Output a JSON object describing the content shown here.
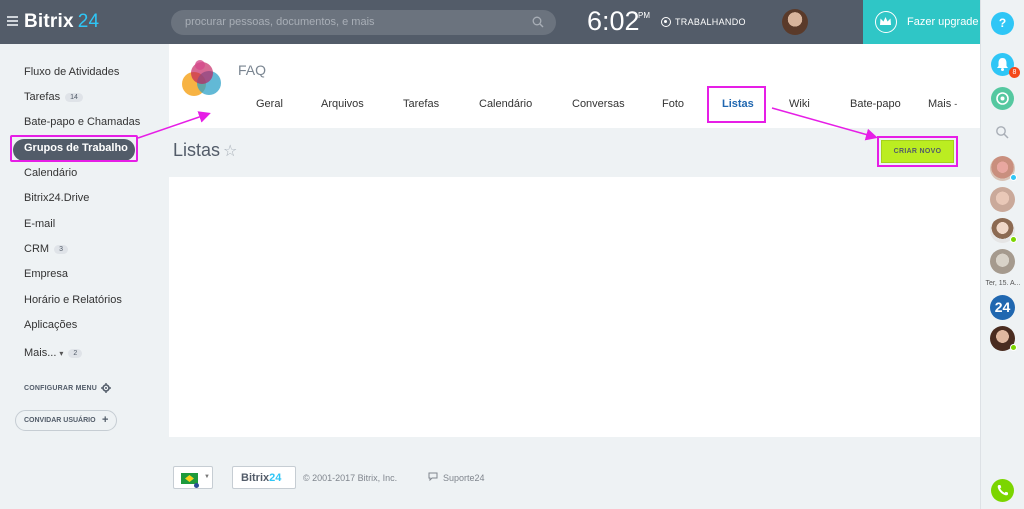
{
  "header": {
    "logo_text": "Bitrix",
    "logo_number": "24",
    "search_placeholder": "procurar pessoas, documentos, e mais",
    "time": "6:02",
    "time_suffix": "PM",
    "work_status": "TRABALHANDO",
    "upgrade_label": "Fazer upgrade"
  },
  "sidebar": {
    "items": [
      {
        "label": "Fluxo de Atividades"
      },
      {
        "label": "Tarefas",
        "count": "14"
      },
      {
        "label": "Bate-papo e Chamadas"
      },
      {
        "label": "Grupos de Trabalho",
        "active": true
      },
      {
        "label": "Calendário"
      },
      {
        "label": "Bitrix24.Drive"
      },
      {
        "label": "E-mail"
      },
      {
        "label": "CRM",
        "count": "3"
      },
      {
        "label": "Empresa"
      },
      {
        "label": "Horário e Relatórios"
      },
      {
        "label": "Aplicações"
      },
      {
        "label": "Mais...",
        "count": "2"
      }
    ],
    "configure_label": "CONFIGURAR MENU",
    "invite_label": "CONVIDAR USUÁRIO"
  },
  "group": {
    "name": "FAQ",
    "tabs": [
      {
        "label": "Geral"
      },
      {
        "label": "Arquivos"
      },
      {
        "label": "Tarefas"
      },
      {
        "label": "Calendário"
      },
      {
        "label": "Conversas"
      },
      {
        "label": "Foto"
      },
      {
        "label": "Listas",
        "active": true
      },
      {
        "label": "Wiki"
      },
      {
        "label": "Bate-papo"
      },
      {
        "label": "Mais"
      }
    ]
  },
  "page": {
    "title": "Listas",
    "star": "☆",
    "create_label": "CRIAR NOVO"
  },
  "rail": {
    "help": "?",
    "notif_count": "8",
    "date_label": "Ter, 15. A...",
    "b24_label": "24"
  },
  "footer": {
    "b24_text": "Bitrix",
    "b24_number": "24",
    "copyright": "© 2001-2017 Bitrix, Inc.",
    "support": "Suporte24"
  },
  "colors": {
    "header_bg": "#535c69",
    "accent_blue": "#2fc6f6",
    "upgrade_bg": "#2fc6c6",
    "create_btn": "#bbed21",
    "annotation": "#e61ee6",
    "active_tab": "#2067b0"
  },
  "icons": {
    "menu": "hamburger-icon",
    "search": "search-icon",
    "crown": "crown-icon",
    "bell": "bell-icon",
    "chat": "chat-icon",
    "phone": "phone-icon",
    "gear": "gear-icon",
    "plus": "plus-icon",
    "star": "star-icon",
    "comment": "comment-icon"
  }
}
